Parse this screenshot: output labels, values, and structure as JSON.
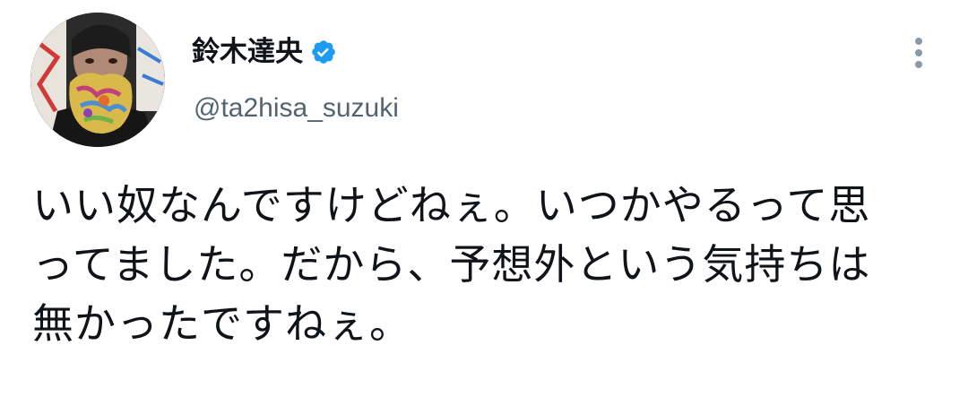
{
  "author": {
    "display_name": "鈴木達央",
    "handle": "@ta2hisa_suzuki",
    "verified": true,
    "avatar_icon": "profile-photo"
  },
  "actions": {
    "more_icon": "more-vertical-icon"
  },
  "tweet": {
    "lines": [
      "いい奴なんですけどねぇ。いつかやるって思",
      "ってました。だから、予想外という気持ちは",
      "無かったですねぇ。"
    ]
  },
  "colors": {
    "text": "#0f1419",
    "secondary_text": "#536471",
    "verified_blue": "#1d9bf0",
    "icon_gray": "#8b98a5",
    "background": "#ffffff"
  }
}
